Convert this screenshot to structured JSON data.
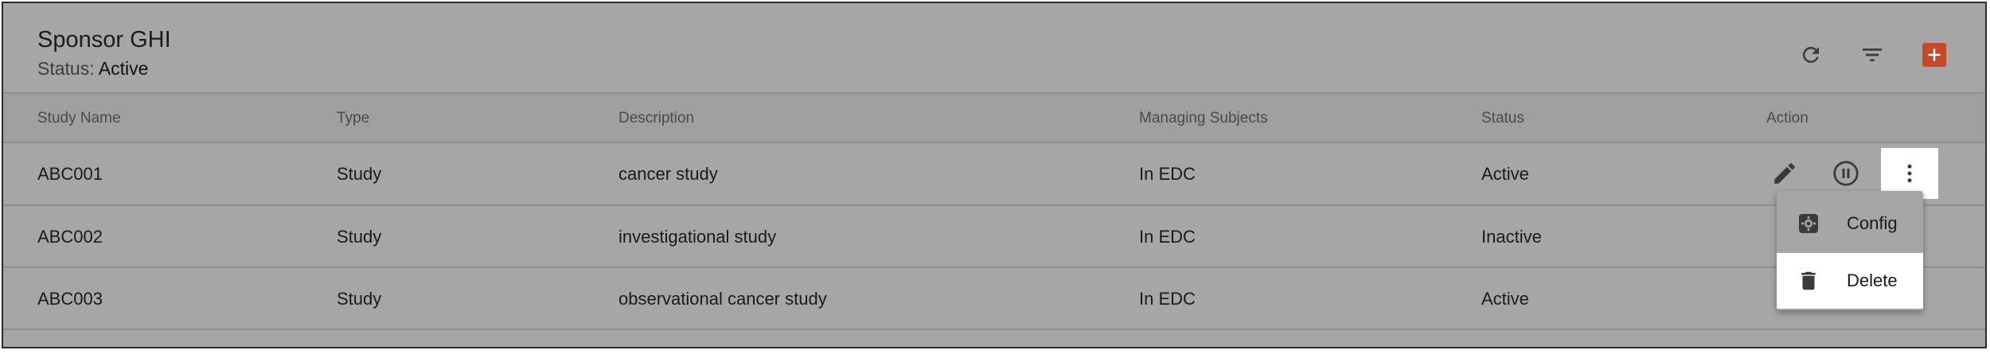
{
  "sponsor": {
    "name": "Sponsor GHI",
    "status_label": "Status:",
    "status_value": "Active"
  },
  "toolbar": {
    "refresh_icon": "refresh-icon",
    "filter_icon": "filter-icon",
    "add_icon": "plus-icon",
    "add_color": "#c6492b"
  },
  "table": {
    "columns": [
      "Study Name",
      "Type",
      "Description",
      "Managing Subjects",
      "Status",
      "Action"
    ],
    "rows": [
      {
        "name": "ABC001",
        "type": "Study",
        "description": "cancer study",
        "managing": "In EDC",
        "status": "Active"
      },
      {
        "name": "ABC002",
        "type": "Study",
        "description": "investigational study",
        "managing": "In EDC",
        "status": "Inactive"
      },
      {
        "name": "ABC003",
        "type": "Study",
        "description": "observational cancer study",
        "managing": "In EDC",
        "status": "Active"
      }
    ]
  },
  "action_menu": {
    "items": [
      {
        "label": "Config",
        "icon": "gear-icon"
      },
      {
        "label": "Delete",
        "icon": "trash-icon"
      }
    ]
  }
}
